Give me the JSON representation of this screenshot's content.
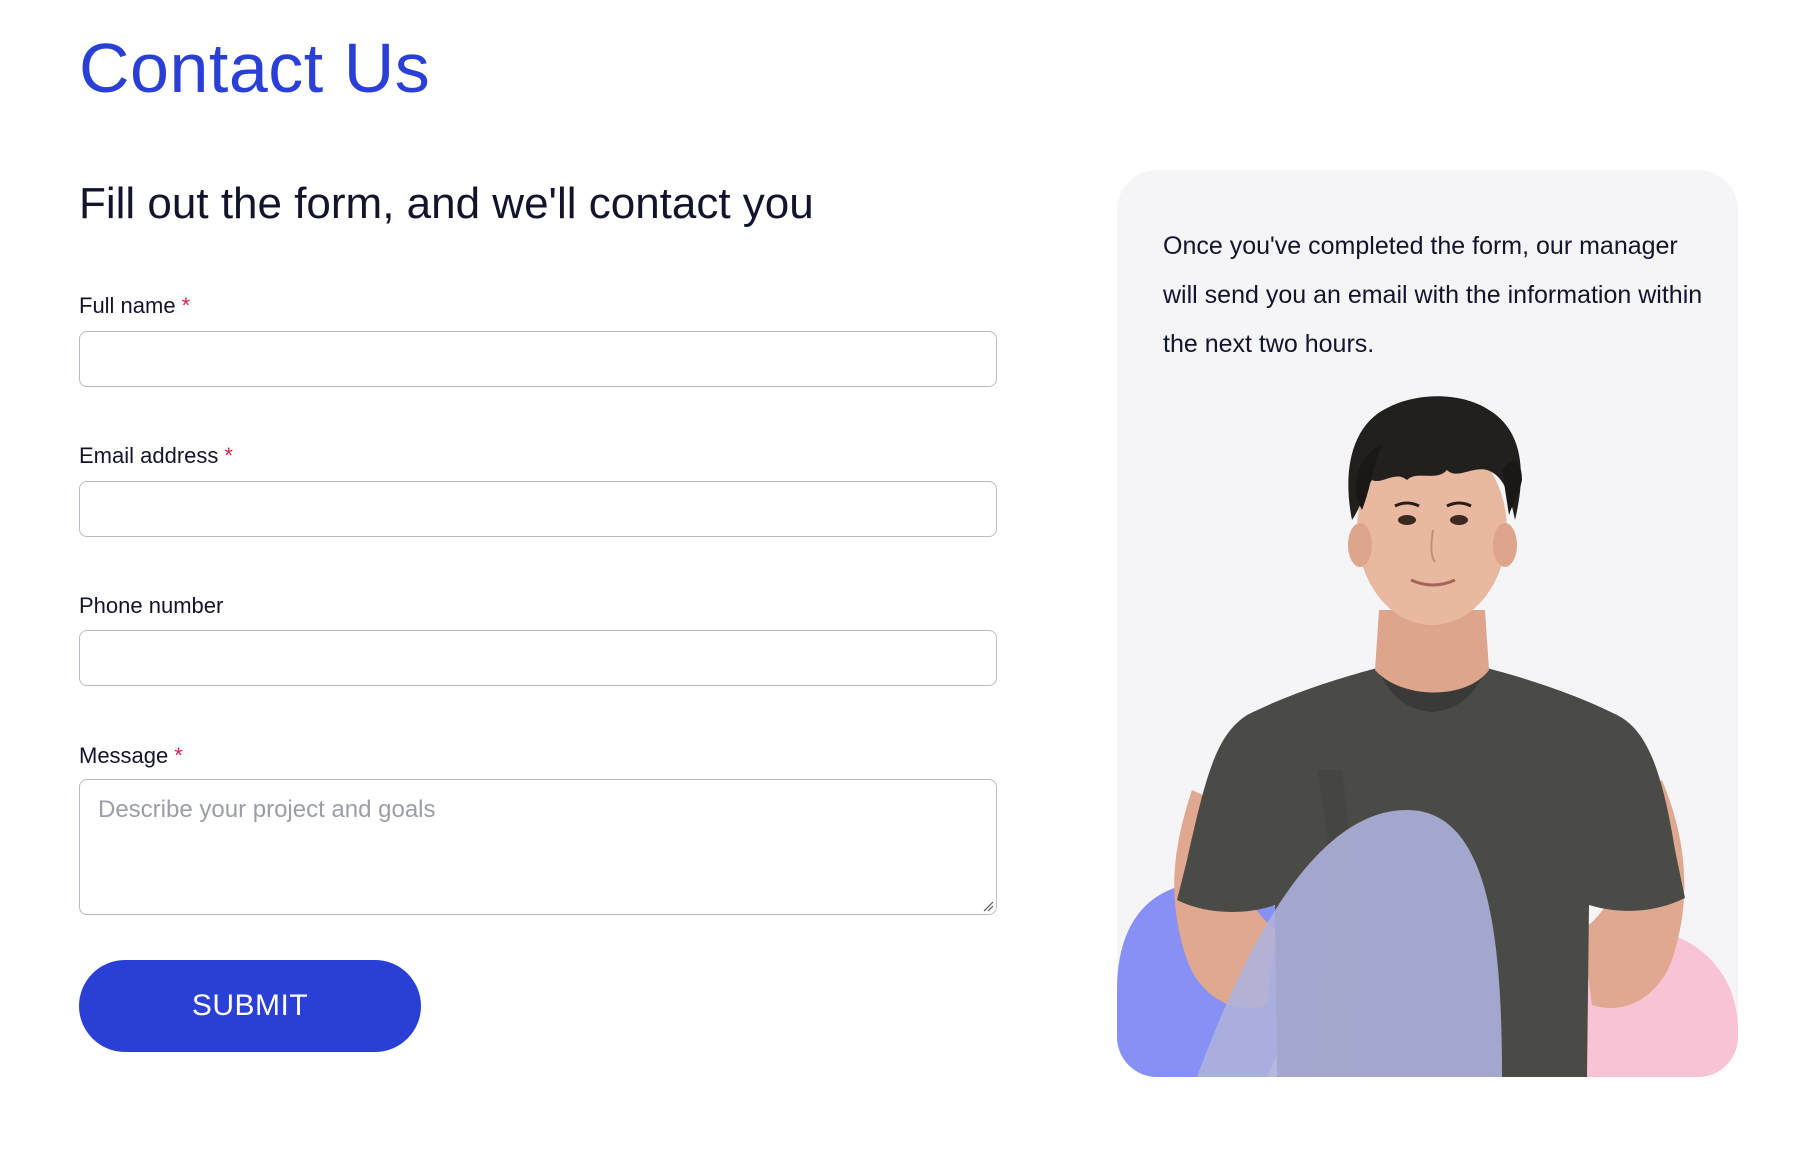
{
  "page": {
    "title": "Contact Us",
    "form_heading": "Fill out the form, and we'll contact you"
  },
  "form": {
    "fields": [
      {
        "label": "Full name",
        "required_mark": "*",
        "value": ""
      },
      {
        "label": "Email address",
        "required_mark": "*",
        "value": ""
      },
      {
        "label": "Phone number",
        "value": ""
      },
      {
        "label": "Message",
        "required_mark": "*",
        "value": "",
        "placeholder": "Describe your project and goals"
      }
    ],
    "submit_label": "SUBMIT"
  },
  "info_card": {
    "text": "Once you've completed the form, our manager will send you an email with the information within the next two hours."
  },
  "colors": {
    "accent": "#2a3fd6",
    "required": "#d6224a",
    "card_bg": "#f5f5f7",
    "blob_blue": "#8791f5",
    "blob_pink": "#f9c3d6",
    "blob_lavender": "#aeb1dc",
    "shirt": "#4a4b47"
  }
}
